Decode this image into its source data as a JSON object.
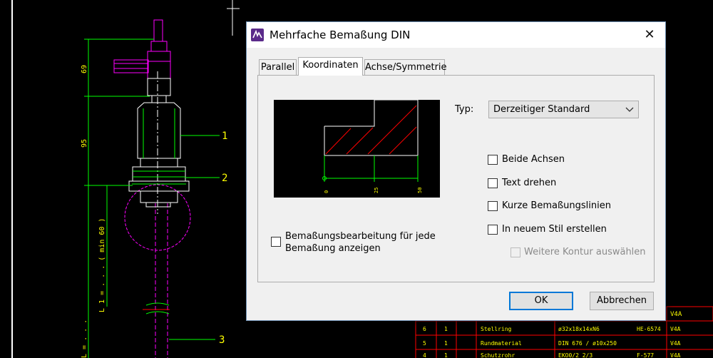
{
  "dialog": {
    "title": "Mehrfache Bemaßung DIN",
    "close_glyph": "✕",
    "tabs": [
      {
        "label": "Parallel",
        "active": false
      },
      {
        "label": "Koordinaten",
        "active": true
      },
      {
        "label": "Achse/Symmetrie",
        "active": false
      }
    ],
    "typ_label": "Typ:",
    "typ_value": "Derzeitiger Standard",
    "checkboxes": {
      "beide_achsen": {
        "label": "Beide Achsen",
        "checked": false
      },
      "text_drehen": {
        "label": "Text drehen",
        "checked": false
      },
      "kurze_linien": {
        "label": "Kurze Bemaßungslinien",
        "checked": false
      },
      "neuer_stil": {
        "label": "In neuem Stil erstellen",
        "checked": false
      },
      "weitere_kontur": {
        "label": "Weitere Kontur auswählen",
        "checked": false,
        "disabled": true
      },
      "bearbeitung_line1": "Bemaßungsbearbeitung für jede",
      "bearbeitung_line2": "Bemaßung anzeigen"
    },
    "buttons": {
      "ok": "OK",
      "cancel": "Abbrechen"
    },
    "preview_ticks": [
      "0",
      "25",
      "50"
    ]
  },
  "cad": {
    "dims": [
      "69",
      "95",
      "L 1 = . . . ( min 60 )",
      "L = . . ."
    ],
    "callouts": [
      "1",
      "2",
      "3"
    ],
    "table": [
      [
        "6",
        "1",
        "Stellring",
        "ø32x18x14xN6",
        "HE-6574",
        "V4A"
      ],
      [
        "5",
        "1",
        "Rundmaterial",
        "DIN 676 / ø10x250",
        "",
        "V4A"
      ],
      [
        "4",
        "1",
        "Schutzrohr",
        "EKO0/2 2/3",
        "F-577",
        "V4A"
      ]
    ],
    "table_top_right": "V4A",
    "colors": {
      "yellow": "#ffff00",
      "green": "#00ff00",
      "magenta": "#ff00ff",
      "red": "#ff0000",
      "white": "#ffffff"
    }
  }
}
